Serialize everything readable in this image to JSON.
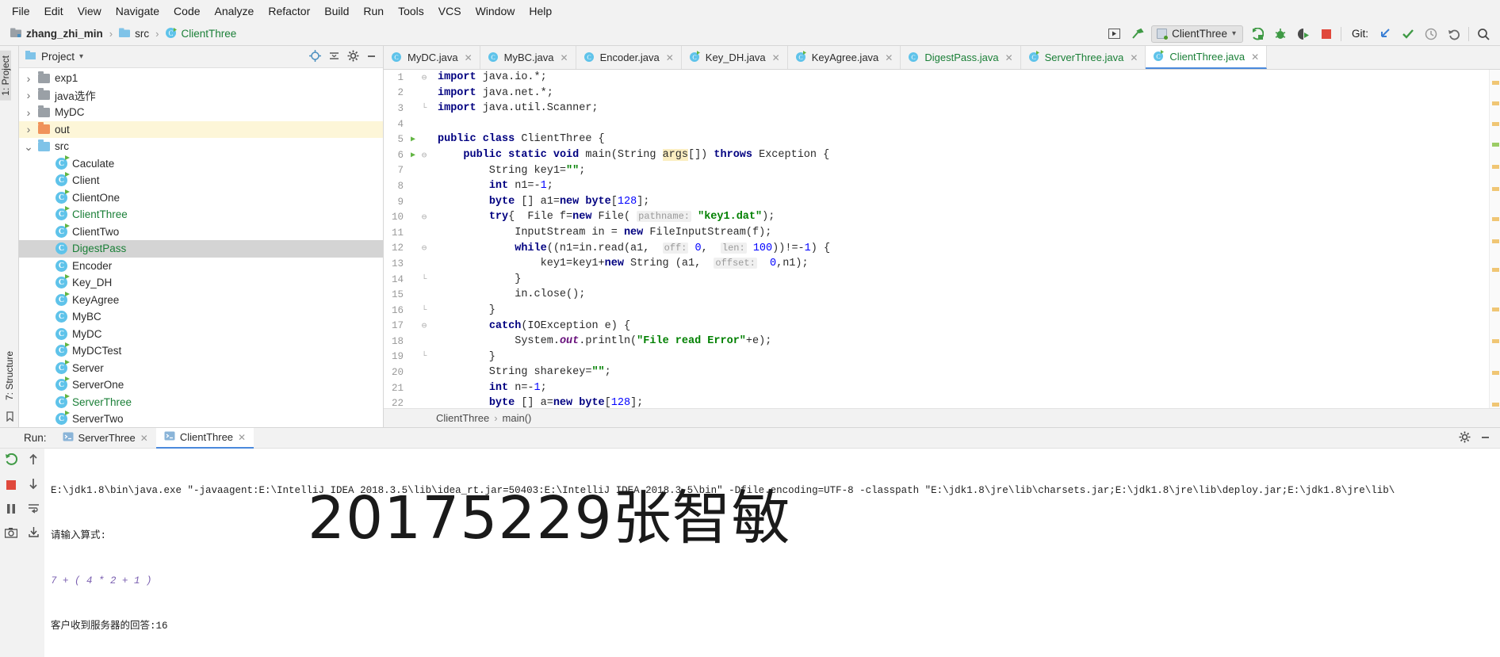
{
  "menu": {
    "items": [
      "File",
      "Edit",
      "View",
      "Navigate",
      "Code",
      "Analyze",
      "Refactor",
      "Build",
      "Run",
      "Tools",
      "VCS",
      "Window",
      "Help"
    ]
  },
  "navbar": {
    "breadcrumbs": [
      {
        "label": "zhang_zhi_min",
        "icon": "project-module-icon",
        "style": "bold"
      },
      {
        "label": "src",
        "icon": "folder-icon",
        "style": "normal"
      },
      {
        "label": "ClientThree",
        "icon": "java-class-icon",
        "style": "green"
      }
    ],
    "run_config": "ClientThree",
    "git_label": "Git:",
    "icons": {
      "select_opened_file": "select-opened-file-icon",
      "hammer": "build-icon",
      "run": "run-icon",
      "debug": "debug-icon",
      "run_coverage": "run-with-coverage-icon",
      "stop": "stop-icon",
      "git_update": "git-update-project-icon",
      "git_commit": "git-commit-icon",
      "git_history": "git-history-icon",
      "git_rollback": "git-rollback-icon",
      "search": "search-everywhere-icon"
    }
  },
  "left_rail": {
    "project_tab": "1: Project",
    "structure_tab": "7: Structure",
    "favorites_icon": "favorites-icon"
  },
  "project": {
    "title": "Project",
    "header_icons": [
      "locate-icon",
      "collapse-all-icon",
      "settings-gear-icon",
      "hide-icon"
    ],
    "tree": [
      {
        "label": "exp1",
        "type": "folder",
        "color": "grey",
        "arrow": "collapsed",
        "indent": 1
      },
      {
        "label": "java选作",
        "type": "folder",
        "color": "grey",
        "arrow": "collapsed",
        "indent": 1
      },
      {
        "label": "MyDC",
        "type": "folder",
        "color": "grey",
        "arrow": "collapsed",
        "indent": 1
      },
      {
        "label": "out",
        "type": "folder",
        "color": "orange",
        "arrow": "collapsed",
        "indent": 1,
        "state": "highlight"
      },
      {
        "label": "src",
        "type": "folder",
        "color": "blue",
        "arrow": "expanded",
        "indent": 1
      },
      {
        "label": "Caculate",
        "type": "class",
        "runnable": true,
        "indent": 2
      },
      {
        "label": "Client",
        "type": "class",
        "runnable": true,
        "indent": 2
      },
      {
        "label": "ClientOne",
        "type": "class",
        "runnable": true,
        "indent": 2
      },
      {
        "label": "ClientThree",
        "type": "class",
        "runnable": true,
        "indent": 2,
        "color": "green"
      },
      {
        "label": "ClientTwo",
        "type": "class",
        "runnable": true,
        "indent": 2
      },
      {
        "label": "DigestPass",
        "type": "class",
        "runnable": false,
        "indent": 2,
        "color": "green",
        "state": "selected"
      },
      {
        "label": "Encoder",
        "type": "class",
        "runnable": false,
        "indent": 2
      },
      {
        "label": "Key_DH",
        "type": "class",
        "runnable": true,
        "indent": 2
      },
      {
        "label": "KeyAgree",
        "type": "class",
        "runnable": true,
        "indent": 2
      },
      {
        "label": "MyBC",
        "type": "class",
        "runnable": false,
        "indent": 2
      },
      {
        "label": "MyDC",
        "type": "class",
        "runnable": false,
        "indent": 2
      },
      {
        "label": "MyDCTest",
        "type": "class",
        "runnable": true,
        "indent": 2
      },
      {
        "label": "Server",
        "type": "class",
        "runnable": true,
        "indent": 2
      },
      {
        "label": "ServerOne",
        "type": "class",
        "runnable": true,
        "indent": 2
      },
      {
        "label": "ServerThree",
        "type": "class",
        "runnable": true,
        "indent": 2,
        "color": "green"
      },
      {
        "label": "ServerTwo",
        "type": "class",
        "runnable": true,
        "indent": 2
      }
    ]
  },
  "editor": {
    "tabs": [
      {
        "label": "MyDC.java",
        "runnable": false,
        "active": false
      },
      {
        "label": "MyBC.java",
        "runnable": false,
        "active": false
      },
      {
        "label": "Encoder.java",
        "runnable": false,
        "active": false
      },
      {
        "label": "Key_DH.java",
        "runnable": true,
        "active": false
      },
      {
        "label": "KeyAgree.java",
        "runnable": true,
        "active": false
      },
      {
        "label": "DigestPass.java",
        "runnable": false,
        "active": false,
        "color": "green"
      },
      {
        "label": "ServerThree.java",
        "runnable": true,
        "active": false,
        "color": "green"
      },
      {
        "label": "ClientThree.java",
        "runnable": true,
        "active": true,
        "color": "green"
      }
    ],
    "breadcrumb": [
      "ClientThree",
      "main()"
    ],
    "first_line": 1,
    "lines": [
      {
        "n": 1,
        "fold": "start",
        "run": false
      },
      {
        "n": 2,
        "fold": "",
        "run": false
      },
      {
        "n": 3,
        "fold": "end",
        "run": false
      },
      {
        "n": 4,
        "fold": "",
        "run": false
      },
      {
        "n": 5,
        "fold": "",
        "run": true
      },
      {
        "n": 6,
        "fold": "start",
        "run": true
      },
      {
        "n": 7,
        "fold": "",
        "run": false
      },
      {
        "n": 8,
        "fold": "",
        "run": false
      },
      {
        "n": 9,
        "fold": "",
        "run": false
      },
      {
        "n": 10,
        "fold": "start",
        "run": false
      },
      {
        "n": 11,
        "fold": "",
        "run": false
      },
      {
        "n": 12,
        "fold": "start",
        "run": false
      },
      {
        "n": 13,
        "fold": "",
        "run": false
      },
      {
        "n": 14,
        "fold": "end",
        "run": false
      },
      {
        "n": 15,
        "fold": "",
        "run": false
      },
      {
        "n": 16,
        "fold": "end",
        "run": false
      },
      {
        "n": 17,
        "fold": "start",
        "run": false
      },
      {
        "n": 18,
        "fold": "",
        "run": false
      },
      {
        "n": 19,
        "fold": "end",
        "run": false
      },
      {
        "n": 20,
        "fold": "",
        "run": false
      },
      {
        "n": 21,
        "fold": "",
        "run": false
      },
      {
        "n": 22,
        "fold": "",
        "run": false
      }
    ],
    "code_text": "import java.io.*;\nimport java.net.*;\nimport java.util.Scanner;\n\npublic class ClientThree {\n    public static void main(String args[]) throws Exception {\n        String key1=\"\";\n        int n1=-1;\n        byte [] a1=new byte[128];\n        try{  File f=new File( pathname: \"key1.dat\");\n            InputStream in = new FileInputStream(f);\n            while((n1=in.read(a1,  off: 0,  len: 100))!=-1) {\n                key1=key1+new String (a1,  offset:  0,n1);\n            }\n            in.close();\n        }\n        catch(IOException e) {\n            System.out.println(\"File read Error\"+e);\n        }\n        String sharekey=\"\";\n        int n=-1;\n        byte [] a=new byte[128];"
  },
  "run_panel": {
    "label": "Run:",
    "tabs": [
      {
        "label": "ServerThree",
        "active": false
      },
      {
        "label": "ClientThree",
        "active": true
      }
    ],
    "header_icons": [
      "settings-gear-icon",
      "hide-icon"
    ],
    "rail_icons": [
      "rerun-icon",
      "up-arrow-icon",
      "stop-icon",
      "down-arrow-icon",
      "pause-icon",
      "soft-wrap-icon",
      "camera-icon",
      "export-icon"
    ],
    "console": {
      "command": "E:\\jdk1.8\\bin\\java.exe \"-javaagent:E:\\IntelliJ IDEA 2018.3.5\\lib\\idea_rt.jar=50403:E:\\IntelliJ IDEA 2018.3.5\\bin\" -Dfile.encoding=UTF-8 -classpath \"E:\\jdk1.8\\jre\\lib\\charsets.jar;E:\\jdk1.8\\jre\\lib\\deploy.jar;E:\\jdk1.8\\jre\\lib\\",
      "prompt": "请输入算式:",
      "input": "7 + ( 4 * 2 + 1 )",
      "answer": "客户收到服务器的回答:16"
    }
  },
  "watermark": "20175229张智敏",
  "colors": {
    "accent_blue": "#4a89dc",
    "green": "#1a7f37",
    "run_green": "#62b543",
    "stop_red": "#e05d44",
    "folder_orange": "#f0935a",
    "selection_grey": "#d4d4d4",
    "highlight_yellow": "#fdf6d8"
  }
}
